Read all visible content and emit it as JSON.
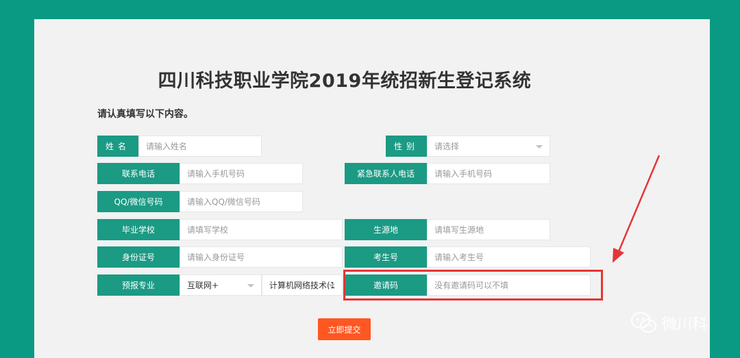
{
  "title": "四川科技职业学院2019年统招新生登记系统",
  "subtitle": "请认真填写以下内容。",
  "fields": {
    "name": {
      "label": "姓名",
      "placeholder": "请输入姓名"
    },
    "gender": {
      "label": "性别",
      "placeholder": "请选择"
    },
    "phone": {
      "label": "联系电话",
      "placeholder": "请输入手机号码"
    },
    "emergency_phone": {
      "label": "紧急联系人电话",
      "placeholder": "请输入手机号码"
    },
    "qq": {
      "label": "QQ/微信号码",
      "placeholder": "请输入QQ/微信号码"
    },
    "school": {
      "label": "毕业学校",
      "placeholder": "请填写学校"
    },
    "origin": {
      "label": "生源地",
      "placeholder": "请填写生源地"
    },
    "id_number": {
      "label": "身份证号",
      "placeholder": "请输入身份证号"
    },
    "exam_number": {
      "label": "考生号",
      "placeholder": "请输入考生号"
    },
    "major": {
      "label": "预报专业",
      "category_value": "互联网+",
      "major_value": "计算机网络技术(1"
    },
    "invite": {
      "label": "邀请码",
      "placeholder": "没有邀请码可以不填"
    }
  },
  "submit_label": "立即提交",
  "watermark": "微川科",
  "colors": {
    "background": "#0a9a83",
    "label": "#1b9a84",
    "submit": "#ff5722",
    "highlight": "#e53535"
  }
}
